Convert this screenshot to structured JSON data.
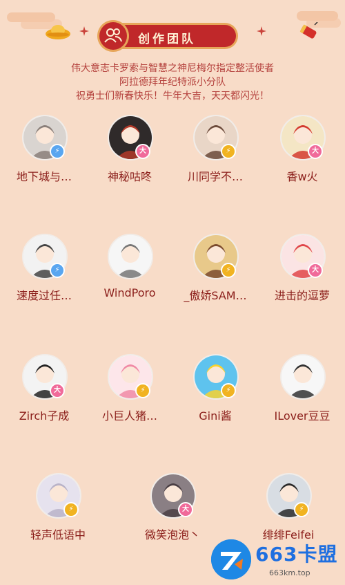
{
  "header": {
    "title": "创作团队",
    "subtitle_lines": [
      "伟大意志卡罗索与智慧之神尼梅尔指定整活使者",
      "阿拉德拜年纪特派小分队",
      "祝勇士们新春快乐！牛年大吉，天天都闪光！"
    ]
  },
  "members": [
    {
      "name": "地下城与…",
      "badge": "⚡",
      "badge_color": "blue",
      "avatar": "girl-silver-hair"
    },
    {
      "name": "神秘咕咚",
      "badge": "大",
      "badge_color": "pink",
      "avatar": "dark-swordsman"
    },
    {
      "name": "川同学不…",
      "badge": "⚡",
      "badge_color": "gold",
      "avatar": "brown-hair-boy"
    },
    {
      "name": "香w火",
      "badge": "大",
      "badge_color": "pink",
      "avatar": "blonde-girl-red-bow"
    },
    {
      "name": "速度过任…",
      "badge": "⚡",
      "badge_color": "blue",
      "avatar": "meme-face"
    },
    {
      "name": "WindPoro",
      "badge": "",
      "badge_color": "",
      "avatar": "sketch-cat"
    },
    {
      "name": "_傲娇SAM…",
      "badge": "⚡",
      "badge_color": "gold",
      "avatar": "blonde-warrior"
    },
    {
      "name": "进击的逗萝",
      "badge": "大",
      "badge_color": "pink",
      "avatar": "red-hair-chibi"
    },
    {
      "name": "Zirch子成",
      "badge": "大",
      "badge_color": "pink",
      "avatar": "man-black-suit"
    },
    {
      "name": "小巨人猪…",
      "badge": "⚡",
      "badge_color": "gold",
      "avatar": "pig-hat-girl"
    },
    {
      "name": "Gini酱",
      "badge": "⚡",
      "badge_color": "gold",
      "avatar": "yellow-duck"
    },
    {
      "name": "ILover豆豆",
      "badge": "",
      "badge_color": "",
      "avatar": "glasses-sketch"
    },
    {
      "name": "轻声低语中",
      "badge": "⚡",
      "badge_color": "gold",
      "avatar": "white-hair-anime"
    },
    {
      "name": "微笑泡泡丶",
      "badge": "大",
      "badge_color": "pink",
      "avatar": "dark-hair-photo"
    },
    {
      "name": "绯绯Feifei",
      "badge": "⚡",
      "badge_color": "gold",
      "avatar": "sunglasses-person"
    }
  ],
  "watermark": {
    "brand": "663卡盟",
    "domain": "663km.top"
  },
  "colors": {
    "background": "#f8dcc8",
    "banner_red": "#c0282a",
    "subtitle": "#b4403c",
    "name": "#8b1e1a"
  }
}
